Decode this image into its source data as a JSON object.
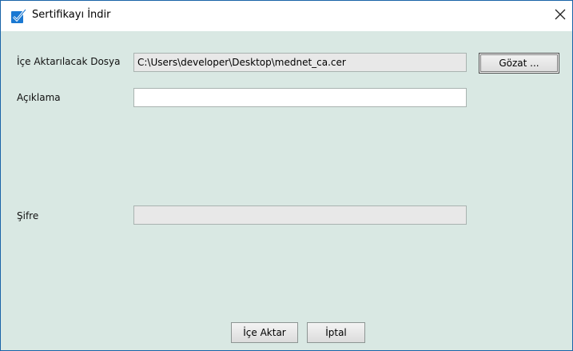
{
  "window": {
    "title": "Sertifikayı İndir",
    "close_glyph": "✕"
  },
  "form": {
    "import_file": {
      "label": "İçe Aktarılacak Dosya",
      "value": "C:\\Users\\developer\\Desktop\\mednet_ca.cer"
    },
    "browse_button": "Gözat ...",
    "description": {
      "label": "Açıklama",
      "value": ""
    },
    "password": {
      "label": "Şifre",
      "value": ""
    }
  },
  "buttons": {
    "import": "İçe Aktar",
    "cancel": "İptal"
  },
  "colors": {
    "background": "#d9e8e3",
    "title_icon": "#1a78d2"
  },
  "icons": {
    "title": "checkbox-icon",
    "close": "close-icon"
  }
}
